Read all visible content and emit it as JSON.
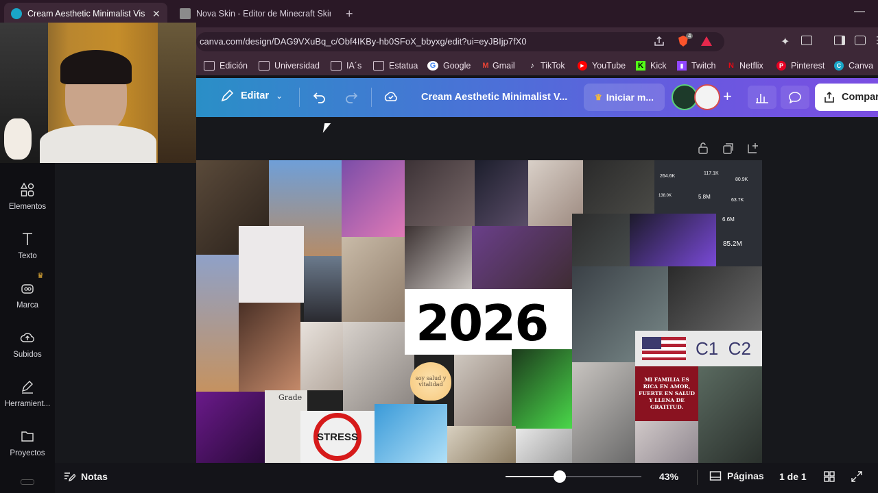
{
  "browser": {
    "tabs": [
      {
        "title": "Cream Aesthetic Minimalist Visio",
        "active": true
      },
      {
        "title": "Nova Skin - Editor de Minecraft Skin",
        "active": false
      }
    ],
    "url": "canva.com/design/DAG9VXuBq_c/Obf4IKBy-hb0SFoX_bbyxg/edit?ui=eyJBIjp7fX0",
    "brave_badge": "4",
    "bookmarks": [
      {
        "label": "Edición",
        "icon": "folder-icon"
      },
      {
        "label": "Universidad",
        "icon": "folder-icon"
      },
      {
        "label": "IA´s",
        "icon": "folder-icon"
      },
      {
        "label": "Estatua",
        "icon": "folder-icon"
      },
      {
        "label": "Google",
        "icon": "google-icon"
      },
      {
        "label": "Gmail",
        "icon": "gmail-icon"
      },
      {
        "label": "TikTok",
        "icon": "tiktok-icon"
      },
      {
        "label": "YouTube",
        "icon": "youtube-icon"
      },
      {
        "label": "Kick",
        "icon": "kick-icon"
      },
      {
        "label": "Twitch",
        "icon": "twitch-icon"
      },
      {
        "label": "Netflix",
        "icon": "netflix-icon"
      },
      {
        "label": "Pinterest",
        "icon": "pinterest-icon"
      },
      {
        "label": "Canva",
        "icon": "canva-icon"
      }
    ]
  },
  "canva": {
    "edit_label": "Editar",
    "design_title": "Cream Aesthetic Minimalist V...",
    "upgrade_label": "Iniciar m...",
    "share_label": "Compar",
    "sidebar": [
      {
        "label": "Elementos",
        "icon": "elements-icon"
      },
      {
        "label": "Texto",
        "icon": "text-icon"
      },
      {
        "label": "Marca",
        "icon": "brand-icon"
      },
      {
        "label": "Subidos",
        "icon": "upload-icon"
      },
      {
        "label": "Herramient...",
        "icon": "tools-icon"
      },
      {
        "label": "Proyectos",
        "icon": "folder-icon"
      }
    ],
    "collage": {
      "year": "2026",
      "heart_text": "soy salud y vitalidad",
      "languages": "C1  C2",
      "affirmation": "MI FAMILIA ES RICA EN AMOR, FUERTE EN SALUD Y LLENA DE GRATITUD.",
      "stats": [
        "264.6K",
        "117.1K",
        "80.9K",
        "138.0K",
        "5.8M",
        "63.7K",
        "6.6M",
        "85.2M"
      ],
      "stress_text": "STRESS",
      "grade_text": "Grade"
    },
    "bottom": {
      "notes_label": "Notas",
      "zoom": "43%",
      "zoom_fraction": 0.4,
      "pages_label": "Páginas",
      "page_count": "1 de 1"
    }
  },
  "colors": {
    "tab_bg": "#2a1826",
    "toolbar_bg": "#3d2837",
    "canva_gradient_start": "#2a8fc7",
    "canva_gradient_end": "#7a4ee2",
    "sidebar_bg": "#0f0f13",
    "canvas_bg": "#17181c"
  }
}
